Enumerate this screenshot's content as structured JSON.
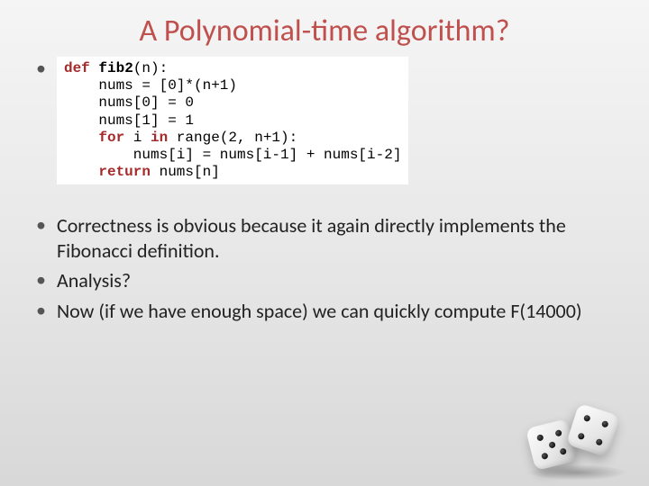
{
  "title": "A Polynomial-time algorithm?",
  "code": {
    "line1_kw": "def",
    "line1_fn": "fib2",
    "line1_rest": "(n):",
    "line2": "    nums = [0]*(n+1)",
    "line3": "    nums[0] = 0",
    "line4": "    nums[1] = 1",
    "line5a": "    ",
    "line5_kw1": "for",
    "line5b": " i ",
    "line5_kw2": "in",
    "line5c": " range(2, n+1):",
    "line6": "        nums[i] = nums[i-1] + nums[i-2]",
    "line7_kw": "    return",
    "line7_rest": " nums[n]"
  },
  "bullets": {
    "b1": "Correctness is obvious because it again directly implements the Fibonacci definition.",
    "b2": "Analysis?",
    "b3": "Now (if we have enough space) we can quickly compute F(14000)"
  }
}
